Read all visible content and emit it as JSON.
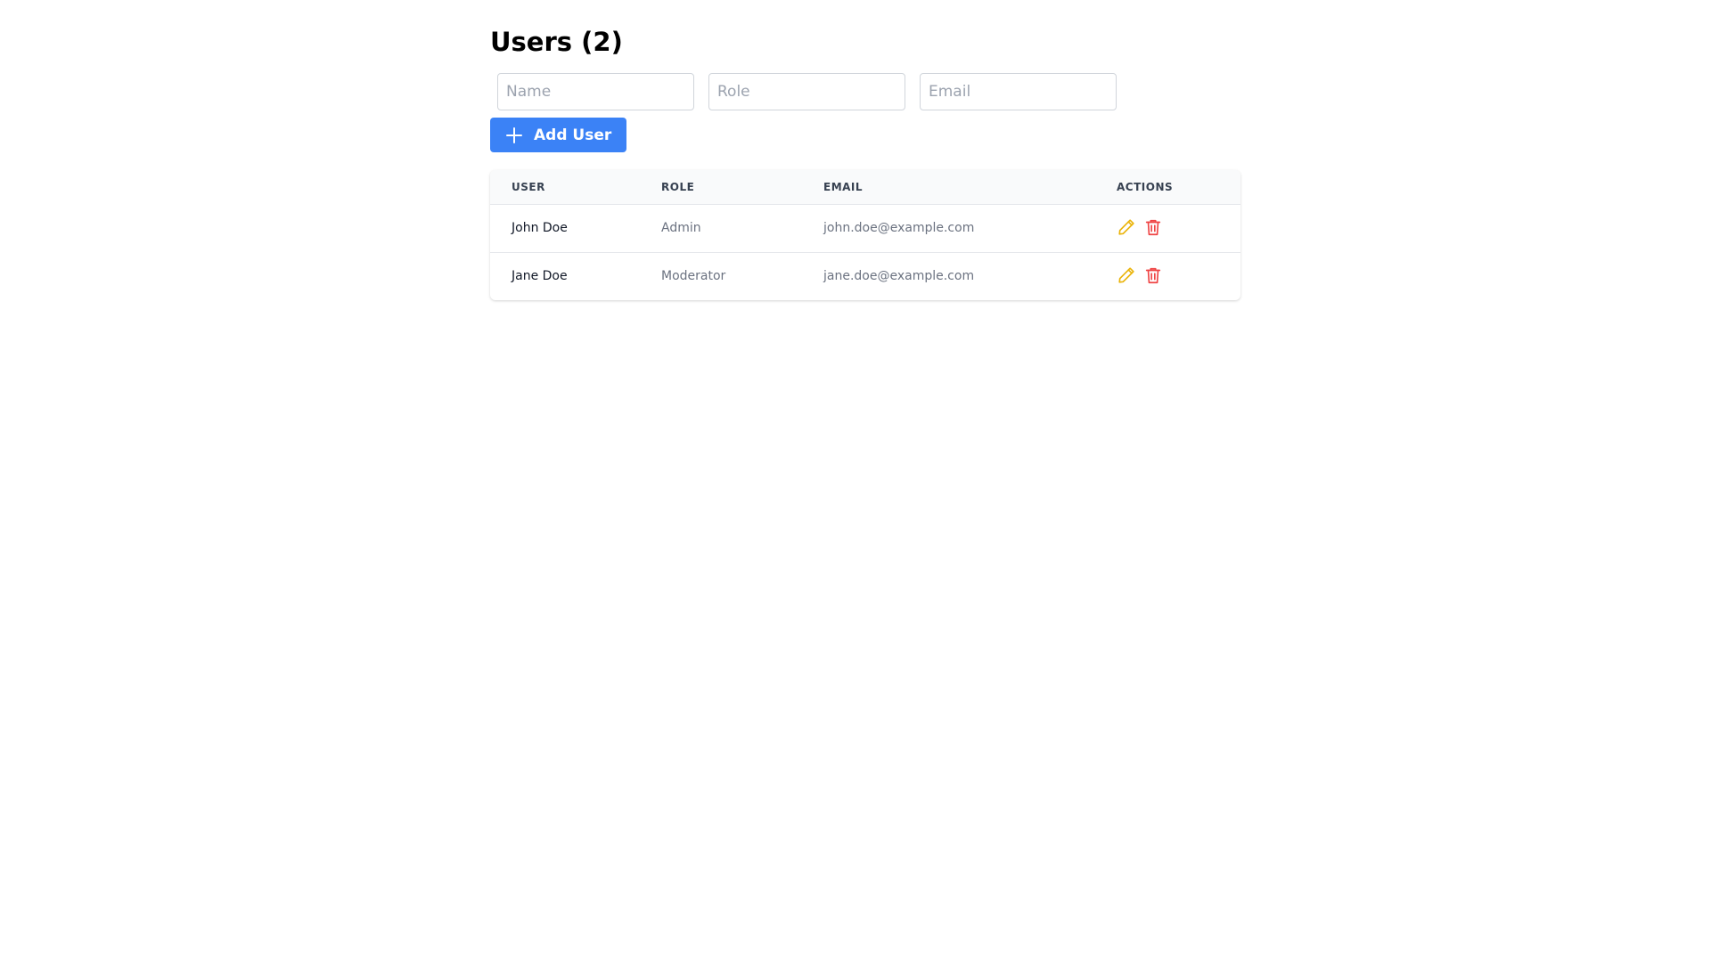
{
  "header": {
    "title": "Users (2)"
  },
  "form": {
    "name_placeholder": "Name",
    "role_placeholder": "Role",
    "email_placeholder": "Email",
    "add_button_label": "Add User",
    "add_button_icon": "plus-icon"
  },
  "table": {
    "columns": [
      "USER",
      "ROLE",
      "EMAIL",
      "ACTIONS"
    ],
    "rows": [
      {
        "name": "John Doe",
        "role": "Admin",
        "email": "john.doe@example.com"
      },
      {
        "name": "Jane Doe",
        "role": "Moderator",
        "email": "jane.doe@example.com"
      }
    ],
    "action_icons": [
      "pencil-icon",
      "trash-icon"
    ]
  },
  "colors": {
    "primary": "#3b82f6",
    "edit": "#eab308",
    "delete": "#ef4444"
  }
}
